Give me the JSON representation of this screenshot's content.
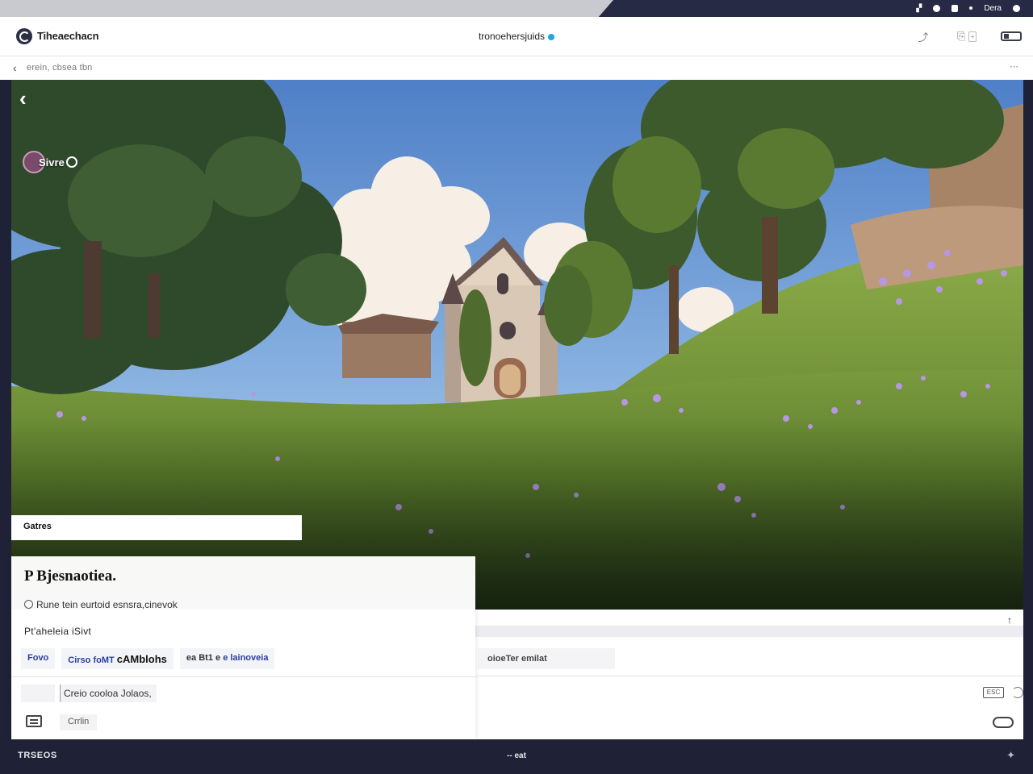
{
  "system_bar": {
    "status_label": "Dera"
  },
  "header": {
    "app_title": "Tiheaechacn",
    "center_title": "tronoehersjuids",
    "box_label": "+"
  },
  "breadcrumb": {
    "text": "erein, cbsea tbn"
  },
  "scene": {
    "creator_name": "Sivre"
  },
  "caption": {
    "text": "Gatres"
  },
  "info_panel": {
    "title": "P Bjesnaotiea.",
    "meta": "Rune tein eurtoid esnsra,cinevok",
    "subtitle": "Pt'aheleia iSivt",
    "tabs": [
      {
        "label": "Fovo"
      },
      {
        "label": "Cirso foMT",
        "strong": "cAMblohs"
      },
      {
        "label": "ea Bt1 e",
        "strong_label": "e lainoveia"
      }
    ],
    "chip": "Creio cooloa   Jolaos,",
    "bottom_chip": "Crrlin"
  },
  "lower_strip": {
    "chip": "oioeTer emilat",
    "icon_box_label": "ESC"
  },
  "bottom_bar": {
    "left": "TRSEOS",
    "center": "--  eat"
  }
}
